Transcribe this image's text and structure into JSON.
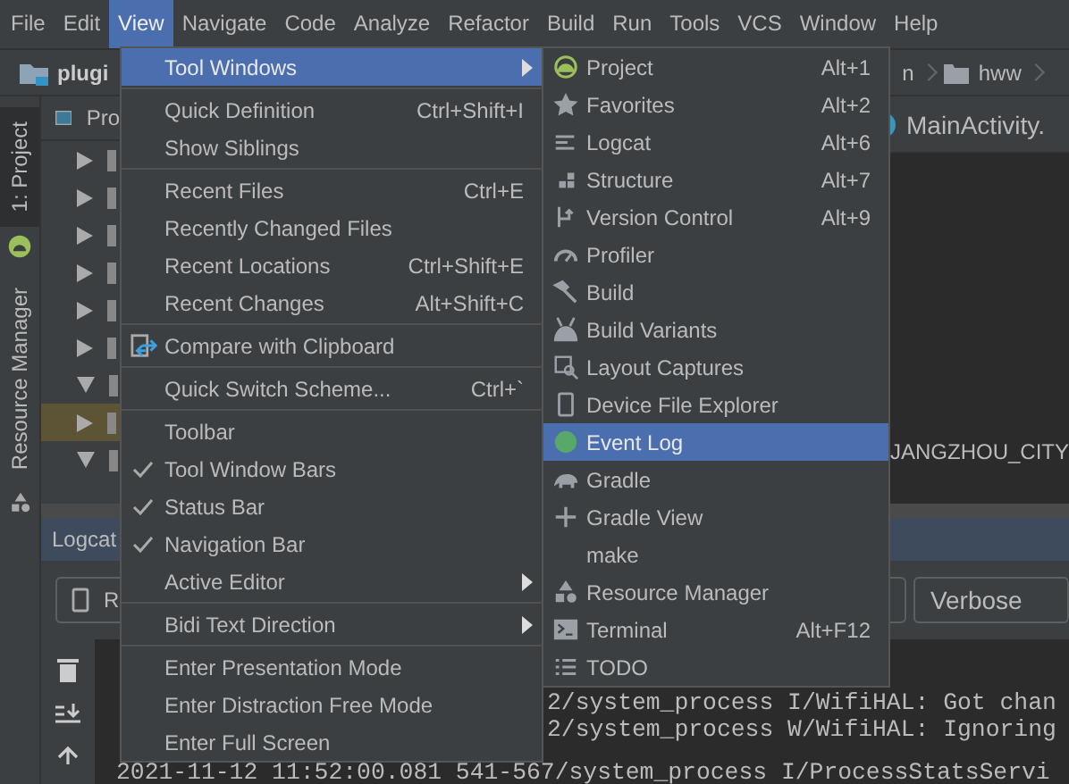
{
  "menu_bar": [
    {
      "label": "File",
      "selected": false
    },
    {
      "label": "Edit",
      "selected": false
    },
    {
      "label": "View",
      "selected": true
    },
    {
      "label": "Navigate",
      "selected": false
    },
    {
      "label": "Code",
      "selected": false
    },
    {
      "label": "Analyze",
      "selected": false
    },
    {
      "label": "Refactor",
      "selected": false
    },
    {
      "label": "Build",
      "selected": false
    },
    {
      "label": "Run",
      "selected": false
    },
    {
      "label": "Tools",
      "selected": false
    },
    {
      "label": "VCS",
      "selected": false
    },
    {
      "label": "Window",
      "selected": false
    },
    {
      "label": "Help",
      "selected": false
    }
  ],
  "nav_bar": {
    "project": "plugi",
    "crumbs": [
      "n",
      "hww"
    ]
  },
  "tool_stripe": [
    "1: Project",
    "Resource Manager"
  ],
  "project_panel": {
    "tab": "Pro",
    "tree": [
      {
        "expanded": false,
        "selected": false
      },
      {
        "expanded": false,
        "selected": false
      },
      {
        "expanded": false,
        "selected": false
      },
      {
        "expanded": false,
        "selected": false
      },
      {
        "expanded": false,
        "selected": false
      },
      {
        "expanded": false,
        "selected": false
      },
      {
        "expanded": true,
        "selected": false
      },
      {
        "expanded": false,
        "selected": true
      },
      {
        "expanded": true,
        "selected": false
      }
    ]
  },
  "editor": {
    "tab": "MainActivity.",
    "line": "JANGZHOU_CITY"
  },
  "logcat": {
    "tab": "Logcat",
    "device": "R",
    "log_level": "Verbose",
    "lines": [
      {
        "kind": "clipped",
        "text": "2/system_process I/WifiHAL: Got chan"
      },
      {
        "kind": "clipped",
        "text": "2/system_process W/WifiHAL: Ignoring"
      },
      {
        "kind": "full",
        "text": "2021-11-12 11:52:00.081 541-567/system_process I/ProcessStatsServi"
      }
    ]
  },
  "view_menu": [
    {
      "kind": "item",
      "label": "Tool Windows",
      "submenu": true,
      "selected": true
    },
    {
      "kind": "separator"
    },
    {
      "kind": "item",
      "label": "Quick Definition",
      "shortcut": "Ctrl+Shift+I"
    },
    {
      "kind": "item",
      "label": "Show Siblings"
    },
    {
      "kind": "separator"
    },
    {
      "kind": "item",
      "label": "Recent Files",
      "shortcut": "Ctrl+E"
    },
    {
      "kind": "item",
      "label": "Recently Changed Files"
    },
    {
      "kind": "item",
      "label": "Recent Locations",
      "shortcut": "Ctrl+Shift+E"
    },
    {
      "kind": "item",
      "label": "Recent Changes",
      "shortcut": "Alt+Shift+C"
    },
    {
      "kind": "separator"
    },
    {
      "kind": "item",
      "label": "Compare with Clipboard",
      "icon": true
    },
    {
      "kind": "separator"
    },
    {
      "kind": "item",
      "label": "Quick Switch Scheme...",
      "shortcut": "Ctrl+`"
    },
    {
      "kind": "separator"
    },
    {
      "kind": "check",
      "label": "Toolbar",
      "checked": false
    },
    {
      "kind": "check",
      "label": "Tool Window Bars",
      "checked": true
    },
    {
      "kind": "check",
      "label": "Status Bar",
      "checked": true
    },
    {
      "kind": "check",
      "label": "Navigation Bar",
      "checked": true
    },
    {
      "kind": "item",
      "label": "Active Editor",
      "submenu": true
    },
    {
      "kind": "separator"
    },
    {
      "kind": "item",
      "label": "Bidi Text Direction",
      "submenu": true
    },
    {
      "kind": "separator"
    },
    {
      "kind": "item",
      "label": "Enter Presentation Mode"
    },
    {
      "kind": "item",
      "label": "Enter Distraction Free Mode"
    },
    {
      "kind": "item",
      "label": "Enter Full Screen"
    }
  ],
  "tool_windows_menu": [
    {
      "label": "Project",
      "shortcut": "Alt+1",
      "selected": false
    },
    {
      "label": "Favorites",
      "shortcut": "Alt+2",
      "selected": false
    },
    {
      "label": "Logcat",
      "shortcut": "Alt+6",
      "selected": false
    },
    {
      "label": "Structure",
      "shortcut": "Alt+7",
      "selected": false
    },
    {
      "label": "Version Control",
      "shortcut": "Alt+9",
      "selected": false
    },
    {
      "label": "Profiler",
      "selected": false
    },
    {
      "label": "Build",
      "selected": false
    },
    {
      "label": "Build Variants",
      "selected": false
    },
    {
      "label": "Layout Captures",
      "selected": false
    },
    {
      "label": "Device File Explorer",
      "selected": false
    },
    {
      "label": "Event Log",
      "selected": true
    },
    {
      "label": "Gradle",
      "selected": false
    },
    {
      "label": "Gradle View",
      "selected": false
    },
    {
      "label": "make",
      "selected": false
    },
    {
      "label": "Resource Manager",
      "selected": false
    },
    {
      "label": "Terminal",
      "shortcut": "Alt+F12",
      "selected": false
    },
    {
      "label": "TODO",
      "selected": false
    }
  ]
}
